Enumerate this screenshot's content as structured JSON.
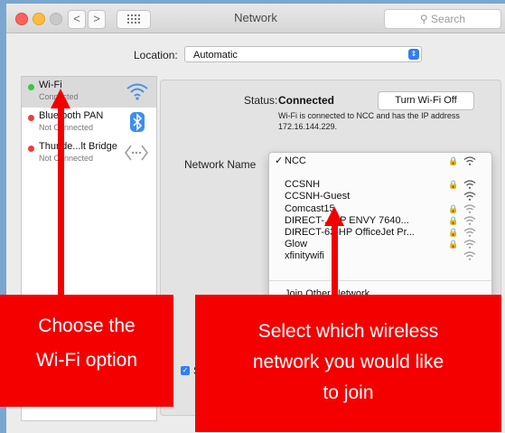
{
  "window": {
    "title": "Network",
    "search_placeholder": "Search",
    "nav_back": "<",
    "nav_forward": ">",
    "grid_icon": "grid-icon"
  },
  "location": {
    "label": "Location:",
    "value": "Automatic"
  },
  "services": [
    {
      "name": "Wi-Fi",
      "status": "Connected",
      "status_color": "#34c749",
      "icon": "wifi-icon",
      "selected": true
    },
    {
      "name": "Bluetooth PAN",
      "status": "Not Connected",
      "status_color": "#ee3c3c",
      "icon": "bluetooth-icon",
      "selected": false
    },
    {
      "name": "Thunde...lt Bridge",
      "status": "Not Connected",
      "status_color": "#ee3c3c",
      "icon": "thunderbolt-bridge-icon",
      "selected": false
    }
  ],
  "status": {
    "label": "Status:",
    "value": "Connected",
    "turn_off_button": "Turn Wi-Fi Off",
    "description": "Wi-Fi is connected to NCC and has the IP address 172.16.144.229."
  },
  "network_name": {
    "label": "Network Name",
    "selected": "NCC",
    "networks": [
      {
        "name": "NCC",
        "locked": true,
        "checked": true
      },
      {
        "name": "CCSNH",
        "locked": true,
        "checked": false
      },
      {
        "name": "CCSNH-Guest",
        "locked": false,
        "checked": false
      },
      {
        "name": "Comcast15",
        "locked": true,
        "checked": false
      },
      {
        "name": "DIRECT-...HP ENVY 7640...",
        "locked": true,
        "checked": false
      },
      {
        "name": "DIRECT-63-HP OfficeJet Pr...",
        "locked": true,
        "checked": false
      },
      {
        "name": "Glow",
        "locked": true,
        "checked": false
      },
      {
        "name": "xfinitywifi",
        "locked": false,
        "checked": false
      }
    ],
    "join_other": "Join Other Network..."
  },
  "checkbox_text": "S",
  "callouts": {
    "left": [
      "Choose the",
      "Wi-Fi option"
    ],
    "right": [
      "Select which wireless",
      "network you would like",
      "to join"
    ]
  },
  "colors": {
    "accent": "#2f7ef6",
    "callout": "#f50000",
    "connected": "#34c749",
    "disconnected": "#ee3c3c"
  }
}
